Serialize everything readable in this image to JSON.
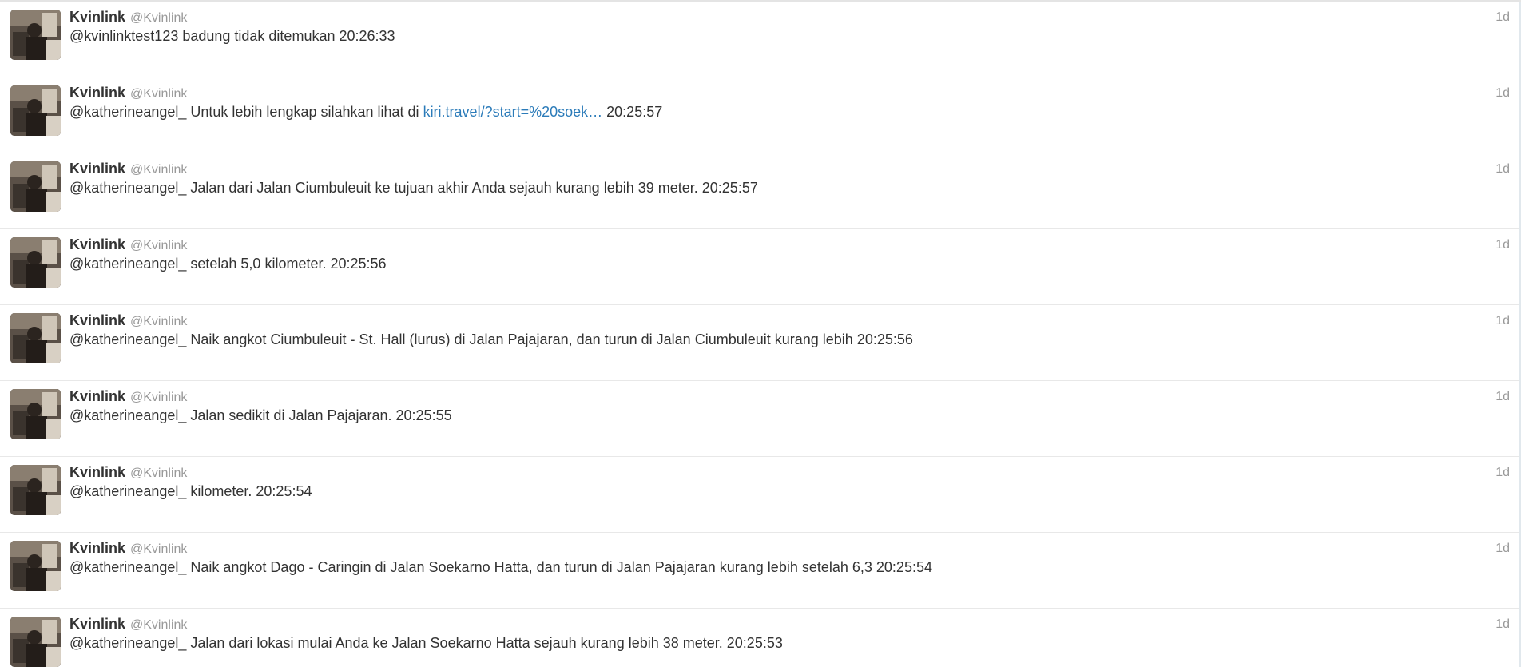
{
  "tweets": [
    {
      "name": "Kvinlink",
      "handle": "@Kvinlink",
      "time": "1d",
      "text_pre": "@kvinlinktest123 badung tidak ditemukan 20:26:33",
      "link": "",
      "text_post": ""
    },
    {
      "name": "Kvinlink",
      "handle": "@Kvinlink",
      "time": "1d",
      "text_pre": "@katherineangel_ Untuk lebih lengkap silahkan lihat di ",
      "link": "kiri.travel/?start=%20soek…",
      "text_post": " 20:25:57"
    },
    {
      "name": "Kvinlink",
      "handle": "@Kvinlink",
      "time": "1d",
      "text_pre": "@katherineangel_ Jalan dari Jalan Ciumbuleuit ke tujuan akhir Anda sejauh kurang lebih 39 meter. 20:25:57",
      "link": "",
      "text_post": ""
    },
    {
      "name": "Kvinlink",
      "handle": "@Kvinlink",
      "time": "1d",
      "text_pre": "@katherineangel_ setelah 5,0 kilometer. 20:25:56",
      "link": "",
      "text_post": ""
    },
    {
      "name": "Kvinlink",
      "handle": "@Kvinlink",
      "time": "1d",
      "text_pre": "@katherineangel_ Naik angkot Ciumbuleuit - St. Hall (lurus) di Jalan Pajajaran, dan turun di Jalan Ciumbuleuit kurang lebih 20:25:56",
      "link": "",
      "text_post": ""
    },
    {
      "name": "Kvinlink",
      "handle": "@Kvinlink",
      "time": "1d",
      "text_pre": "@katherineangel_ Jalan sedikit di Jalan Pajajaran. 20:25:55",
      "link": "",
      "text_post": ""
    },
    {
      "name": "Kvinlink",
      "handle": "@Kvinlink",
      "time": "1d",
      "text_pre": "@katherineangel_ kilometer. 20:25:54",
      "link": "",
      "text_post": ""
    },
    {
      "name": "Kvinlink",
      "handle": "@Kvinlink",
      "time": "1d",
      "text_pre": "@katherineangel_ Naik angkot Dago - Caringin di Jalan Soekarno Hatta, dan turun di Jalan Pajajaran kurang lebih setelah 6,3 20:25:54",
      "link": "",
      "text_post": ""
    },
    {
      "name": "Kvinlink",
      "handle": "@Kvinlink",
      "time": "1d",
      "text_pre": "@katherineangel_ Jalan dari lokasi mulai Anda ke Jalan Soekarno Hatta sejauh kurang lebih 38 meter. 20:25:53",
      "link": "",
      "text_post": ""
    }
  ],
  "colors": {
    "name": "#333333",
    "meta": "#999999",
    "link": "#2b7bb9",
    "divider": "#e8e8e8"
  }
}
